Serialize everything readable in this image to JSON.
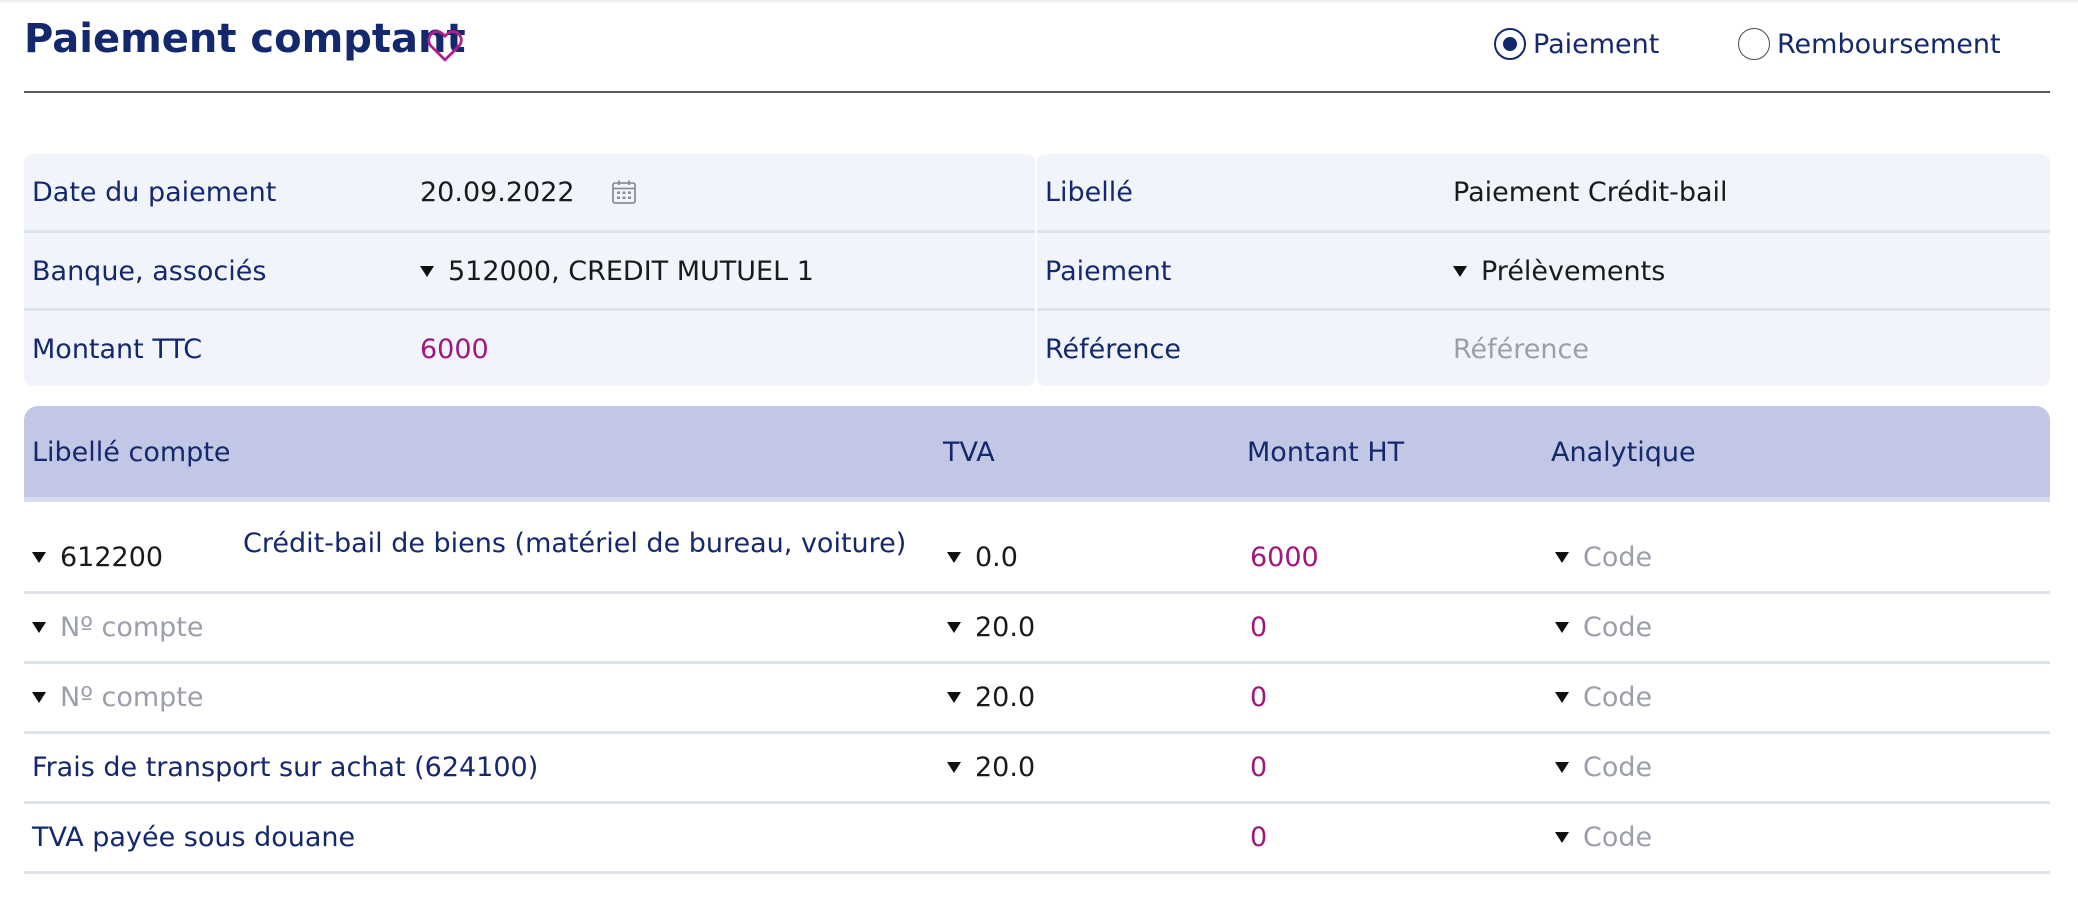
{
  "header": {
    "title": "Paiement comptant",
    "favorite_icon": "heart-icon",
    "radios": [
      {
        "label": "Paiement",
        "checked": true
      },
      {
        "label": "Remboursement",
        "checked": false
      }
    ]
  },
  "form": {
    "left": [
      {
        "label": "Date du paiement",
        "value": "20.09.2022",
        "icon": "calendar-icon"
      },
      {
        "label": "Banque, associés",
        "value": "512000, CREDIT MUTUEL 1",
        "dropdown": true
      },
      {
        "label": "Montant TTC",
        "value": "6000"
      }
    ],
    "right": [
      {
        "label": "Libellé",
        "value": "Paiement Crédit-bail"
      },
      {
        "label": "Paiement",
        "value": "Prélèvements",
        "dropdown": true
      },
      {
        "label": "Référence",
        "placeholder": "Référence"
      }
    ]
  },
  "table": {
    "headers": [
      "Libellé compte",
      "TVA",
      "Montant HT",
      "Analytique"
    ],
    "rows": [
      {
        "account": "612200",
        "account_label": "Crédit-bail de biens (matériel de bureau, voiture)",
        "tva": "0.0",
        "amount": "6000",
        "analytic_placeholder": "Code"
      },
      {
        "account_placeholder": "Nº compte",
        "tva": "20.0",
        "amount": "0",
        "analytic_placeholder": "Code"
      },
      {
        "account_placeholder": "Nº compte",
        "tva": "20.0",
        "amount": "0",
        "analytic_placeholder": "Code"
      },
      {
        "account_label": "Frais de transport sur achat (624100)",
        "tva": "20.0",
        "amount": "0",
        "analytic_placeholder": "Code"
      },
      {
        "account_label": "TVA payée sous douane",
        "amount": "0",
        "analytic_placeholder": "Code"
      }
    ]
  },
  "colors": {
    "primary": "#14286e",
    "accent": "#a0177a",
    "panel_bg": "#f1f5fb",
    "table_header_bg": "#c2c7e6",
    "placeholder": "#9b9faa"
  }
}
